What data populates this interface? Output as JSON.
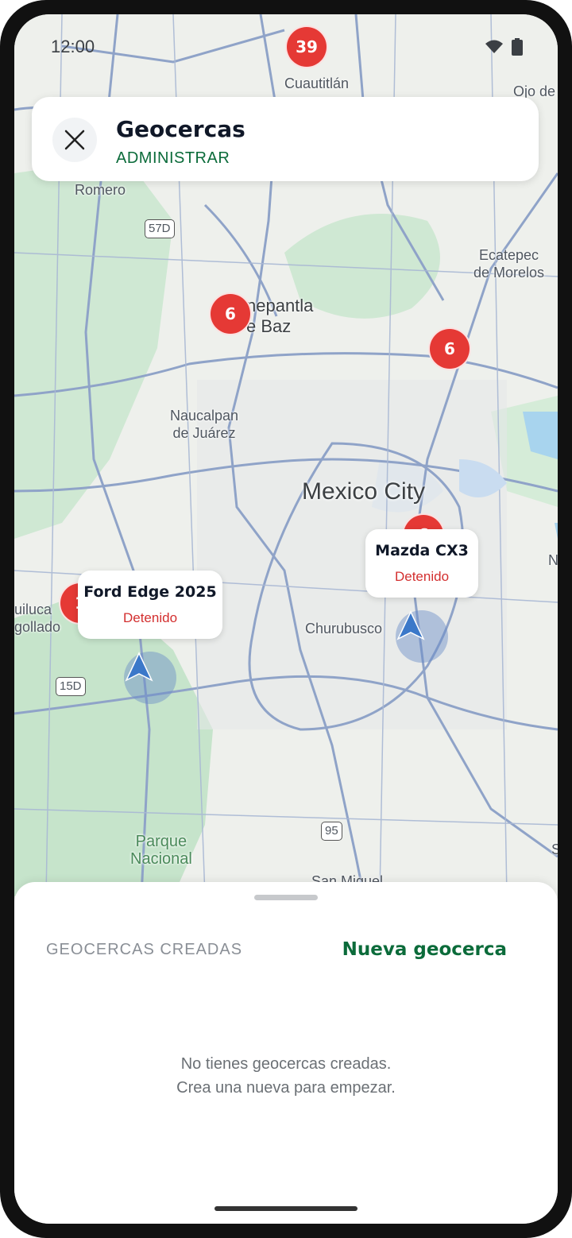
{
  "status_bar": {
    "time": "12:00"
  },
  "header": {
    "title": "Geocercas",
    "subtitle": "ADMINISTRAR"
  },
  "map": {
    "city": "Mexico City",
    "places": {
      "cuautitlan": "Cuautitlán",
      "ojo_de": "Ojo de",
      "romero": "Romero",
      "ecatepec": "Ecatepec\nde Morelos",
      "tlalnepantla": "nepantla\ne Baz",
      "naucalpan": "Naucalpan\nde Juárez",
      "churubusco": "Churubusco",
      "huilucan": "uiluca\ngollado",
      "parque": "Parque\nNacional",
      "san_miguel": "San Miguel",
      "edge_n": "N",
      "edge_s": "S"
    },
    "shields": {
      "h57d": "57D",
      "h15d": "15D",
      "h95": "95"
    },
    "clusters": [
      "39",
      "6",
      "6",
      "1",
      "6"
    ],
    "vehicles": [
      {
        "name": "Ford Edge 2025",
        "status": "Detenido"
      },
      {
        "name": "Mazda CX3",
        "status": "Detenido"
      }
    ]
  },
  "sheet": {
    "tab_created": "GEOCERCAS CREADAS",
    "tab_new": "Nueva geocerca",
    "empty_line1": "No tienes geocercas creadas.",
    "empty_line2": "Crea una nueva para empezar."
  },
  "icons": {
    "close": "close-icon",
    "wifi": "wifi-icon",
    "battery": "battery-icon",
    "navigation": "navigation-arrow-icon"
  },
  "colors": {
    "brand_green": "#0b6b3a",
    "cluster_red": "#e53935",
    "status_red": "#d32f2f"
  }
}
